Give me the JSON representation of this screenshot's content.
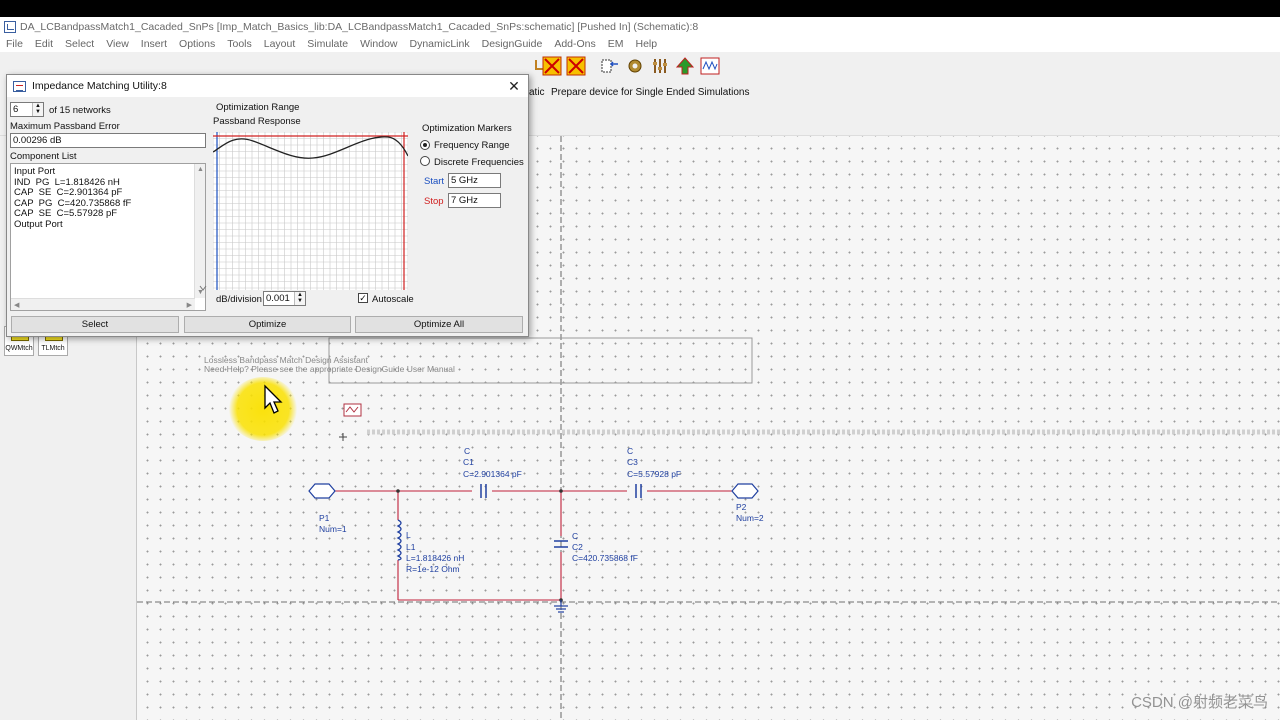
{
  "window": {
    "title": "DA_LCBandpassMatch1_Cacaded_SnPs [Imp_Match_Basics_lib:DA_LCBandpassMatch1_Cacaded_SnPs:schematic] [Pushed In] (Schematic):8"
  },
  "menu": [
    "File",
    "Edit",
    "Select",
    "View",
    "Insert",
    "Options",
    "Tools",
    "Layout",
    "Simulate",
    "Window",
    "DynamicLink",
    "DesignGuide",
    "Add-Ons",
    "EM",
    "Help"
  ],
  "toolbar2": {
    "partial_label": "atic",
    "prepare_label": "Prepare device for Single Ended Simulations"
  },
  "palette": {
    "items": [
      {
        "label": "QWMtch",
        "icon": "qw-match-icon"
      },
      {
        "label": "TLMtch",
        "icon": "tl-match-icon"
      }
    ]
  },
  "dialog": {
    "title": "Impedance Matching Utility:8",
    "network_index": "6",
    "network_of": "of 15 networks",
    "max_error_label": "Maximum Passband Error",
    "max_error_value": "0.00296 dB",
    "component_list_label": "Component List",
    "components": [
      "Input Port",
      "IND  PG  L=1.818426 nH",
      "CAP  SE  C=2.901364 pF",
      "CAP  PG  C=420.735868 fF",
      "CAP  SE  C=5.57928 pF",
      "Output Port"
    ],
    "opt_range_label": "Optimization Range",
    "passband_label": "Passband Response",
    "db_div_label": "dB/division",
    "db_div_value": "0.001",
    "autoscale_label": "Autoscale",
    "autoscale_checked": true,
    "markers_label": "Optimization Markers",
    "freq_range_label": "Frequency Range",
    "discrete_label": "Discrete Frequencies",
    "selected_marker": "Frequency Range",
    "start_label": "Start",
    "start_value": "5 GHz",
    "stop_label": "Stop",
    "stop_value": "7 GHz",
    "buttons": {
      "select": "Select",
      "optimize": "Optimize",
      "optimize_all": "Optimize All"
    },
    "colors": {
      "start": "#1a4fc0",
      "stop": "#d02020",
      "curve": "#222222"
    }
  },
  "schematic": {
    "note_line1": "Lossless Bandpass Match Design Assistant",
    "note_line2": "Need Help?  Please see the appropriate DesignGuide User Manual",
    "c1": {
      "type": "C",
      "name": "C1",
      "value": "C=2.901364 pF"
    },
    "c3": {
      "type": "C",
      "name": "C3",
      "value": "C=5.57928 pF"
    },
    "c2": {
      "type": "C",
      "name": "C2",
      "value": "C=420.735868 fF"
    },
    "l1": {
      "type": "L",
      "name": "L1",
      "value": "L=1.818426 nH",
      "r": "R=1e-12 Ohm"
    },
    "p1": {
      "name": "P1",
      "num": "Num=1"
    },
    "p2": {
      "name": "P2",
      "num": "Num=2"
    },
    "wire_color": "#c0203a",
    "label_color": "#2040a0"
  },
  "watermark": "CSDN @射频老菜鸟"
}
